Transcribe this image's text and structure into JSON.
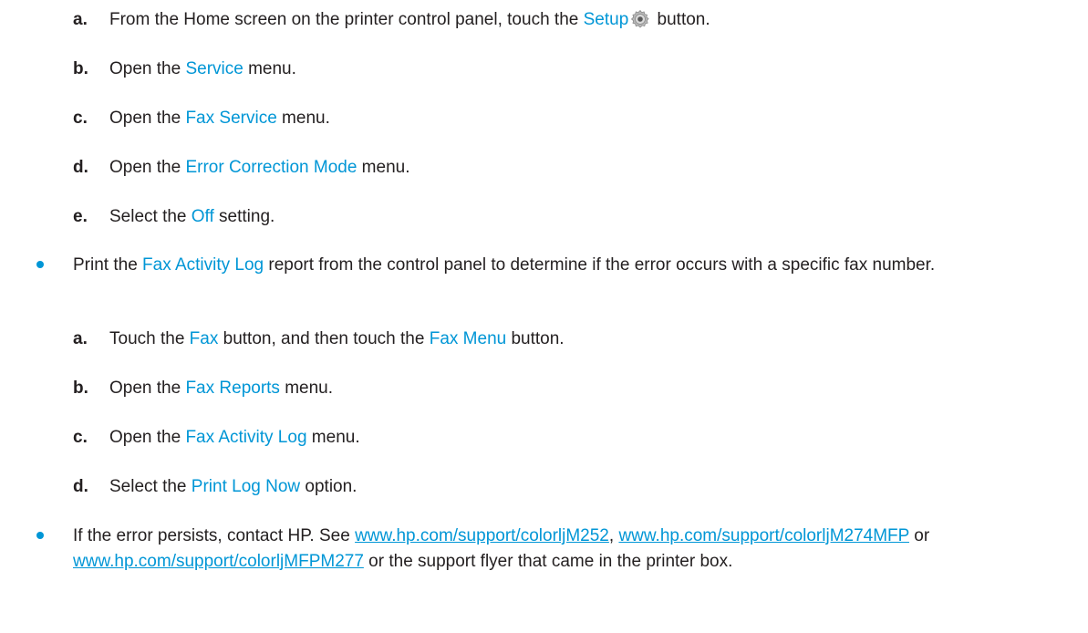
{
  "colors": {
    "accent": "#0096d6",
    "text": "#231f20"
  },
  "steps_a": [
    {
      "letter": "a.",
      "pre": "From the Home screen on the printer control panel, touch the ",
      "hl": "Setup",
      "icon": "gear-icon",
      "post": " button."
    },
    {
      "letter": "b.",
      "pre": "Open the ",
      "hl": "Service",
      "post": " menu."
    },
    {
      "letter": "c.",
      "pre": "Open the ",
      "hl": "Fax Service",
      "post": " menu."
    },
    {
      "letter": "d.",
      "pre": "Open the ",
      "hl": "Error Correction Mode",
      "post": " menu."
    },
    {
      "letter": "e.",
      "pre": "Select the ",
      "hl": "Off",
      "post": " setting."
    }
  ],
  "bullet1": {
    "pre": "Print the ",
    "hl": "Fax Activity Log",
    "post": " report from the control panel to determine if the error occurs with a specific fax number."
  },
  "steps_b": [
    {
      "letter": "a.",
      "pre": "Touch the ",
      "hl": "Fax",
      "mid": " button, and then touch the ",
      "hl2": "Fax Menu",
      "post": " button."
    },
    {
      "letter": "b.",
      "pre": "Open the ",
      "hl": "Fax Reports",
      "post": " menu."
    },
    {
      "letter": "c.",
      "pre": "Open the ",
      "hl": "Fax Activity Log",
      "post": " menu."
    },
    {
      "letter": "d.",
      "pre": "Select the ",
      "hl": "Print Log Now",
      "post": " option."
    }
  ],
  "bullet2": {
    "pre": "If the error persists, contact HP. See ",
    "link1": "www.hp.com/support/colorljM252",
    "sep1": ", ",
    "link2": "www.hp.com/support/colorljM274MFP",
    "sep2": " or ",
    "link3": "www.hp.com/support/colorljMFPM277",
    "post": " or the support flyer that came in the printer box."
  }
}
